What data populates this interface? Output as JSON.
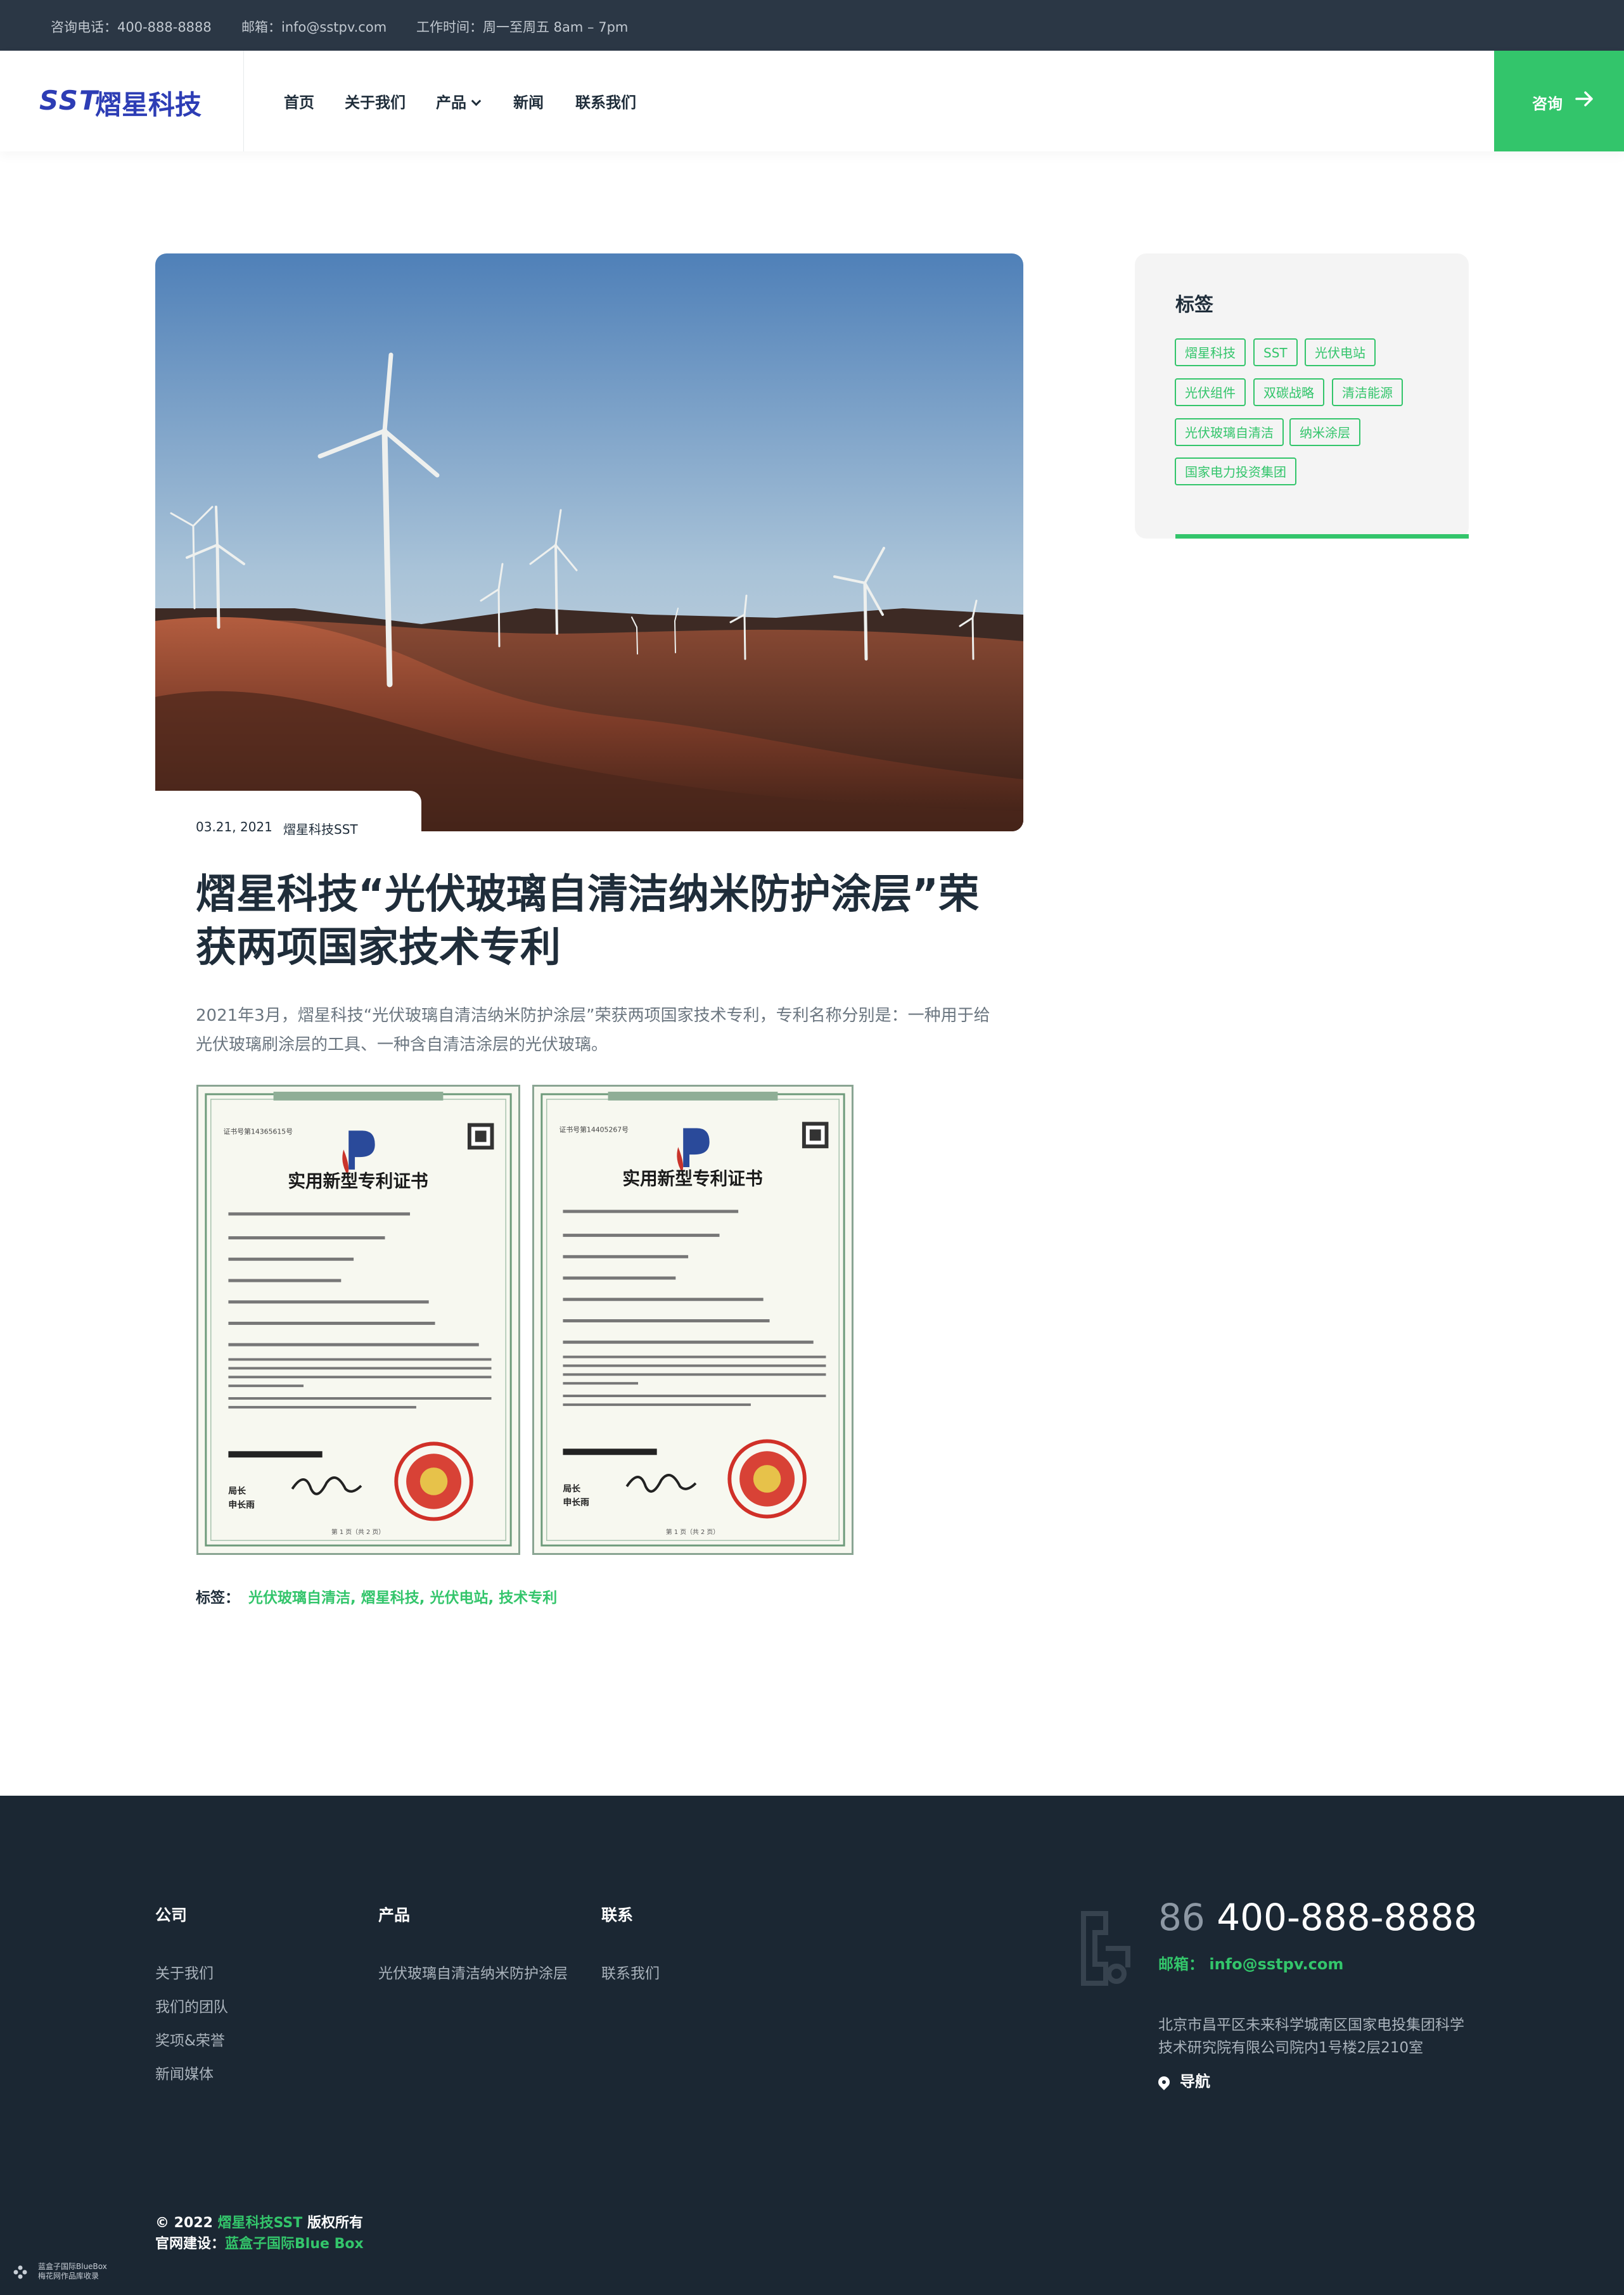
{
  "topbar": {
    "phone": "咨询电话：400-888-8888",
    "email": "邮箱：info@sstpv.com",
    "hours": "工作时间：周一至周五 8am – 7pm"
  },
  "header": {
    "logo_mark": "SST",
    "logo_name": "熠星科技",
    "nav": [
      "首页",
      "关于我们",
      "产品",
      "新闻",
      "联系我们"
    ],
    "consult_label": "咨询"
  },
  "article": {
    "date": "03.21, 2021",
    "author": "熠星科技SST",
    "title": "熠星科技“光伏玻璃自清洁纳米防护涂层”荣获两项国家技术专利",
    "lead": "2021年3月，熠星科技“光伏玻璃自清洁纳米防护涂层”荣获两项国家技术专利，专利名称分别是：一种用于给光伏玻璃刷涂层的工具、一种含自清洁涂层的光伏玻璃。",
    "certificates": [
      {
        "heading": "实用新型专利证书",
        "number": "证书号第14365615号",
        "chief_label": "局长\n申长雨"
      },
      {
        "heading": "实用新型专利证书",
        "number": "证书号第14405267号",
        "chief_label": "局长\n申长雨"
      }
    ],
    "tags_label": "标签：",
    "tags_value": "光伏玻璃自清洁, 熠星科技, 光伏电站, 技术专利"
  },
  "sidebar": {
    "title": "标签",
    "tags": [
      "熠星科技",
      "SST",
      "光伏电站",
      "光伏组件",
      "双碳战略",
      "清洁能源",
      "光伏玻璃自清洁",
      "纳米涂层",
      "国家电力投资集团"
    ]
  },
  "footer": {
    "col_company": {
      "title": "公司",
      "links": [
        "关于我们",
        "我们的团队",
        "奖项&荣誉",
        "新闻媒体"
      ]
    },
    "col_products": {
      "title": "产品",
      "links": [
        "光伏玻璃自清洁纳米防护涂层"
      ]
    },
    "col_contact": {
      "title": "联系",
      "links": [
        "联系我们"
      ]
    },
    "phone_cc": "86",
    "phone": "400-888-8888",
    "email": "邮箱：  info@sstpv.com",
    "address": "北京市昌平区未来科学城南区国家电投集团科学技术研究院有限公司院内1号楼2层210室",
    "navigate": "导航",
    "copyright_prefix": "© 2022 ",
    "copyright_brand": "熠星科技SST",
    "copyright_suffix": " 版权所有",
    "site_label": "官网建设：",
    "site_builder": "蓝盒子国际Blue Box",
    "badge_line1": "蓝盒子国际BlueBox",
    "badge_line2": "梅花网作品库收录"
  },
  "colors": {
    "accent": "#33c56b",
    "brand": "#2d3db5",
    "dark": "#1b2733",
    "topbar": "#2b3745"
  }
}
